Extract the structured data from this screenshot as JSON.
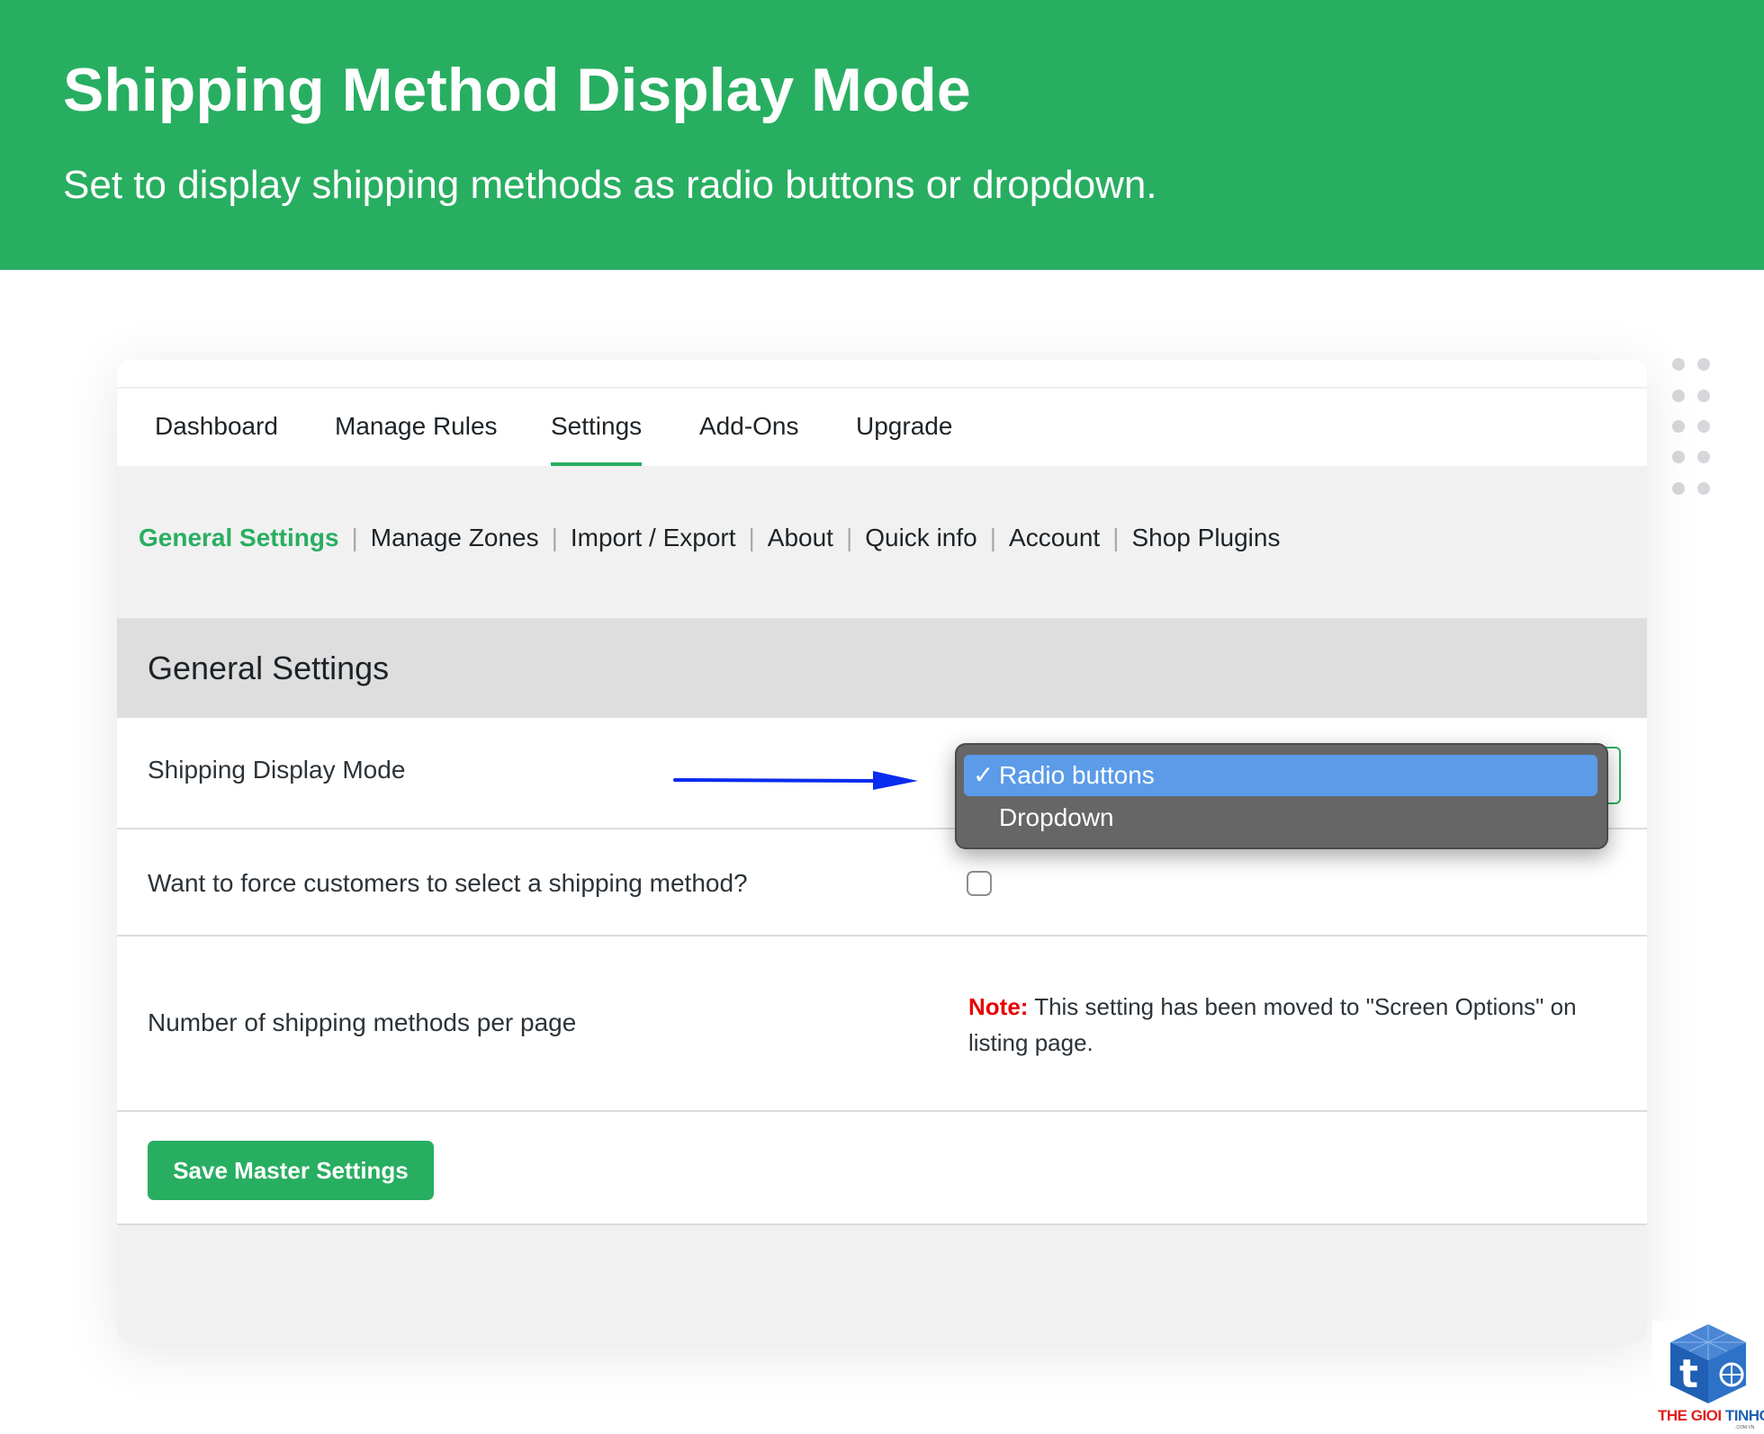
{
  "banner": {
    "title": "Shipping Method Display Mode",
    "subtitle": "Set to display shipping methods as radio buttons or dropdown."
  },
  "nav": {
    "tabs": [
      {
        "label": "Dashboard"
      },
      {
        "label": "Manage Rules"
      },
      {
        "label": "Settings",
        "active": true
      },
      {
        "label": "Add-Ons"
      },
      {
        "label": "Upgrade"
      }
    ]
  },
  "subnav": {
    "items": [
      {
        "label": "General Settings",
        "active": true
      },
      {
        "label": "Manage Zones"
      },
      {
        "label": "Import / Export"
      },
      {
        "label": "About"
      },
      {
        "label": "Quick info"
      },
      {
        "label": "Account"
      },
      {
        "label": "Shop Plugins"
      }
    ],
    "separator": "|"
  },
  "section": {
    "title": "General Settings"
  },
  "settings": {
    "display_mode": {
      "label": "Shipping Display Mode",
      "selected": "Radio buttons",
      "options": [
        {
          "label": "Radio buttons",
          "check": "✓",
          "selected": true
        },
        {
          "label": "Dropdown",
          "check": "",
          "selected": false
        }
      ]
    },
    "force_select": {
      "label": "Want to force customers to select a shipping method?",
      "checked": false
    },
    "per_page": {
      "label": "Number of shipping methods per page",
      "note_label": "Note:",
      "note_text": " This setting has been moved to \"Screen Options\" on listing page."
    }
  },
  "actions": {
    "save_label": "Save Master Settings"
  },
  "logo": {
    "text_red": "THE GIOI ",
    "text_blue": "TINHOC",
    "sub": ".COM.VN",
    "glyph": "t"
  },
  "colors": {
    "banner_green": "#28ae61",
    "active_tab_underline": "#28ae61",
    "note_red": "#e80000",
    "dropdown_highlight": "#5b9be8",
    "arrow_blue": "#0a2cf0",
    "logo_red": "#e02020",
    "logo_blue": "#1f5fb4"
  }
}
